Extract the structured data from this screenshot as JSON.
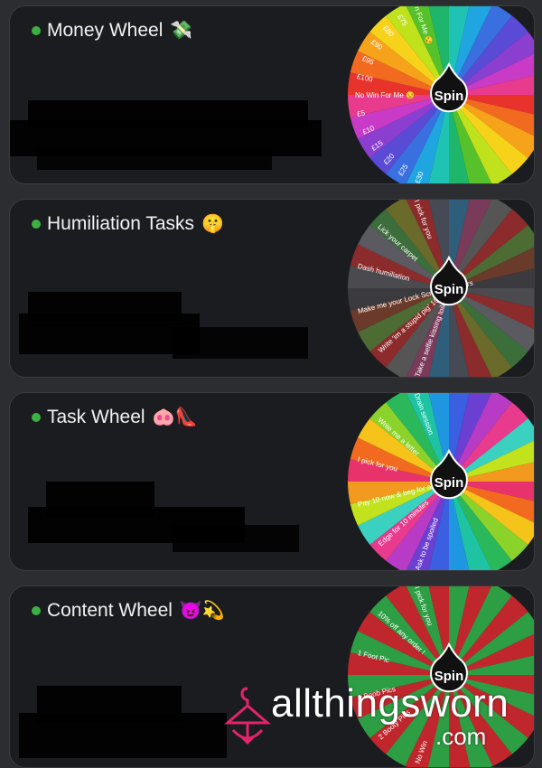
{
  "colors": {
    "background": "#2b2d30",
    "card": "#1b1c1f",
    "online_dot": "#3cb043",
    "spin_button": "#111111"
  },
  "cards": [
    {
      "title": "Money Wheel",
      "emoji": "💸",
      "wheel_colors": [
        "#e8322c",
        "#f26a1f",
        "#f7a21b",
        "#f6d31a",
        "#bfe21c",
        "#57c12b",
        "#1db66a",
        "#1ec3b4",
        "#1fa6e0",
        "#3a6fe0",
        "#5a4bd6",
        "#8b3fd1",
        "#c93bc6",
        "#e83b8e"
      ],
      "wheel_labels": [
        "£30",
        "£25",
        "£20",
        "£15",
        "£10",
        "£5",
        "No Win For Me 😒",
        "£100",
        "£95",
        "£90",
        "£80",
        "£75",
        "n For Me 😒"
      ],
      "button": "Spin"
    },
    {
      "title": "Humiliation Tasks",
      "emoji": "🤫",
      "wheel_colors": [
        "#4a4a4f",
        "#8c2b2b",
        "#5a5a60",
        "#3c6e3c",
        "#6a6a2a",
        "#8c2b2b",
        "#454a55",
        "#2f5e7a",
        "#7a3a5a",
        "#555",
        "#8c2b2b",
        "#4c6c34",
        "#6a3a2a",
        "#3a3a3f"
      ],
      "wheel_labels": [
        "Take a selfie kissing toilet",
        "Write 'im a stupid pig' 10x and send",
        "Make me your Lock Screen for 24hrs",
        "Dash humiliation",
        "Lick your carpet",
        "I pick for you"
      ],
      "button": "Spin"
    },
    {
      "title": "Task Wheel",
      "emoji": "🐽👠",
      "wheel_colors": [
        "#e8326b",
        "#f26a1f",
        "#f6c31a",
        "#8bd32a",
        "#2bb85a",
        "#1ec3a4",
        "#1f96e0",
        "#3a5fe0",
        "#6a3fd1",
        "#b83bc6",
        "#e83b8e",
        "#3bd1c1",
        "#c1e21c",
        "#f29a1f"
      ],
      "wheel_labels": [
        "Ask to be spoiled",
        "Edge for 10 minutes",
        "Pay 10 now & beg for another task",
        "I pick for you",
        "Write me a letter",
        "Drain session"
      ],
      "button": "Spin"
    },
    {
      "title": "Content Wheel",
      "emoji": "😈💫",
      "wheel_colors": [
        "#c0272d",
        "#2e9e44"
      ],
      "wheel_labels": [
        "No Win",
        "2 Booty Pics",
        "3 Boob Pics",
        "1 Foot Pic",
        "10% off any order !",
        "I pick for you"
      ],
      "button": "Spin"
    }
  ],
  "watermark": {
    "text": "allthingsworn",
    "suffix": ".com"
  }
}
